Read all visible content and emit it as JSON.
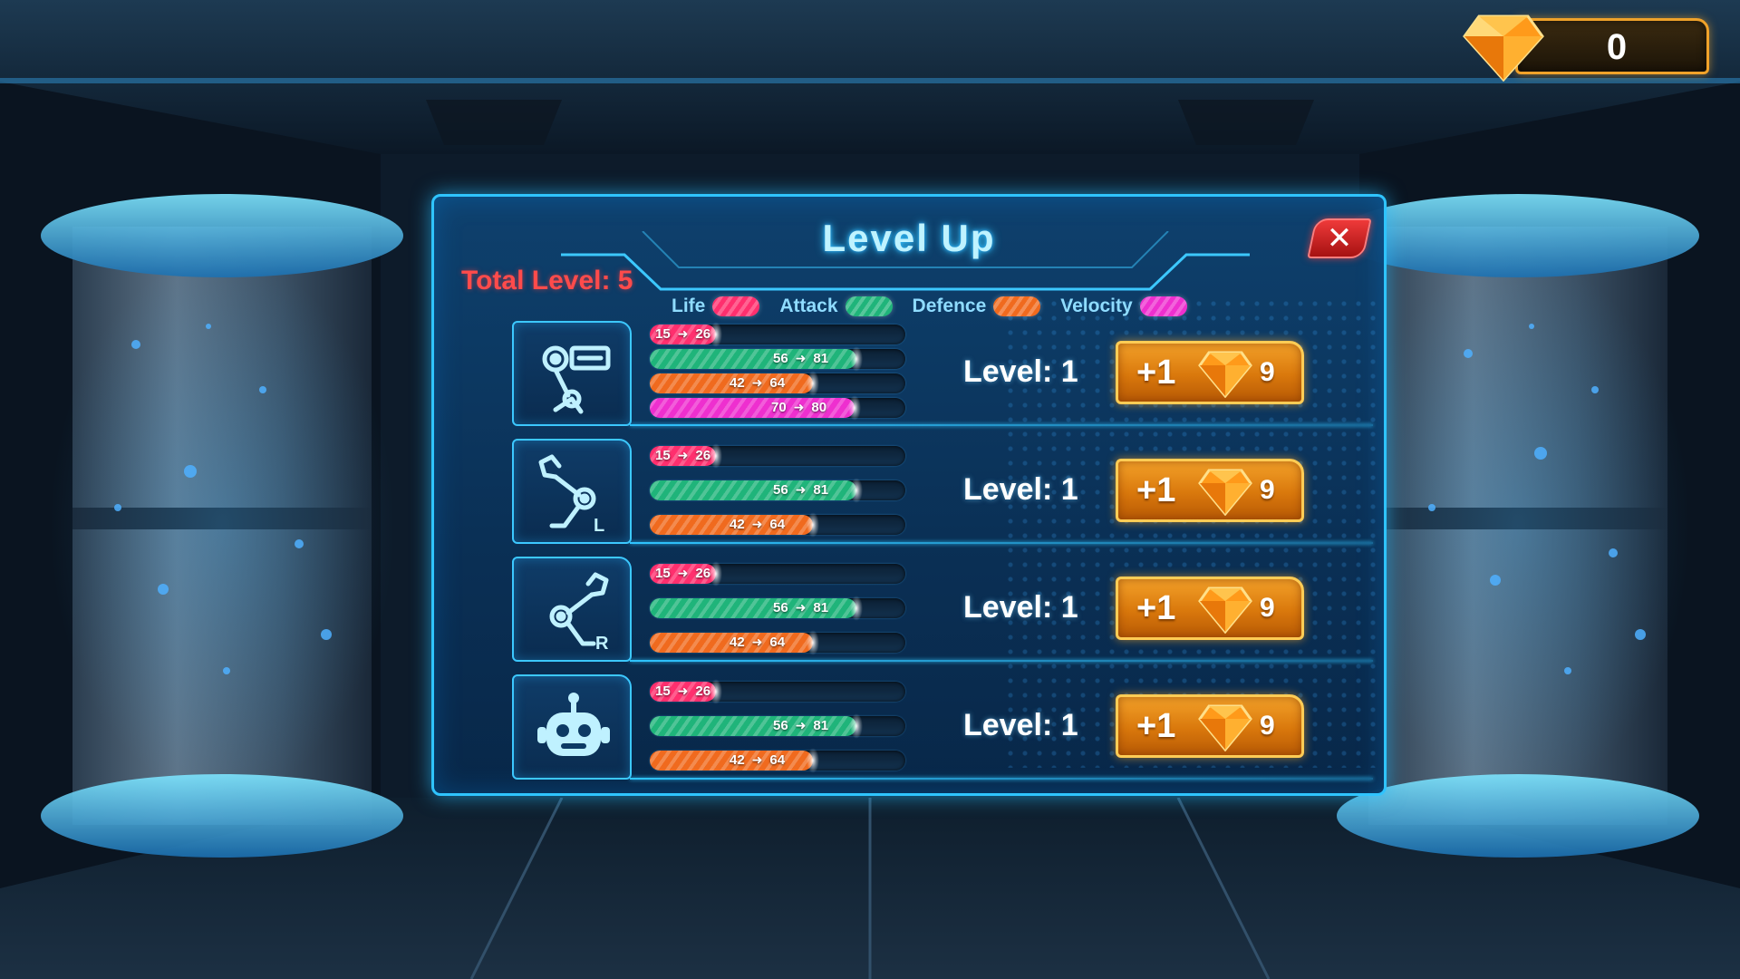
{
  "currency": {
    "gems": "0",
    "icon": "gem-icon"
  },
  "panel": {
    "title": "Level Up",
    "close_label": "✕",
    "total_level": "Total Level: 5"
  },
  "legend": [
    {
      "label": "Life",
      "color": "#ff2f6e"
    },
    {
      "label": "Attack",
      "color": "#1fb47a"
    },
    {
      "label": "Defence",
      "color": "#f06a1e"
    },
    {
      "label": "Velocity",
      "color": "#ee2fcf"
    }
  ],
  "stat_max": 100,
  "parts": [
    {
      "icon": "robot-arm-cannon-icon",
      "level": "Level: 1",
      "upgrade": {
        "plus": "+1",
        "cost": "9"
      },
      "stats": [
        {
          "type": "life",
          "from": "15",
          "to": "26",
          "fill": 26
        },
        {
          "type": "attack",
          "from": "56",
          "to": "81",
          "fill": 81
        },
        {
          "type": "defence",
          "from": "42",
          "to": "64",
          "fill": 64
        },
        {
          "type": "velocity",
          "from": "70",
          "to": "80",
          "fill": 80
        }
      ]
    },
    {
      "icon": "left-arm-claw-icon",
      "level": "Level: 1",
      "upgrade": {
        "plus": "+1",
        "cost": "9"
      },
      "stats": [
        {
          "type": "life",
          "from": "15",
          "to": "26",
          "fill": 26
        },
        {
          "type": "attack",
          "from": "56",
          "to": "81",
          "fill": 81
        },
        {
          "type": "defence",
          "from": "42",
          "to": "64",
          "fill": 64
        }
      ]
    },
    {
      "icon": "right-arm-claw-icon",
      "level": "Level: 1",
      "upgrade": {
        "plus": "+1",
        "cost": "9"
      },
      "stats": [
        {
          "type": "life",
          "from": "15",
          "to": "26",
          "fill": 26
        },
        {
          "type": "attack",
          "from": "56",
          "to": "81",
          "fill": 81
        },
        {
          "type": "defence",
          "from": "42",
          "to": "64",
          "fill": 64
        }
      ]
    },
    {
      "icon": "robot-head-icon",
      "level": "Level: 1",
      "upgrade": {
        "plus": "+1",
        "cost": "9"
      },
      "stats": [
        {
          "type": "life",
          "from": "15",
          "to": "26",
          "fill": 26
        },
        {
          "type": "attack",
          "from": "56",
          "to": "81",
          "fill": 81
        },
        {
          "type": "defence",
          "from": "42",
          "to": "64",
          "fill": 64
        }
      ]
    }
  ],
  "labels": {
    "part_arm_left": "L",
    "part_arm_right": "R"
  }
}
